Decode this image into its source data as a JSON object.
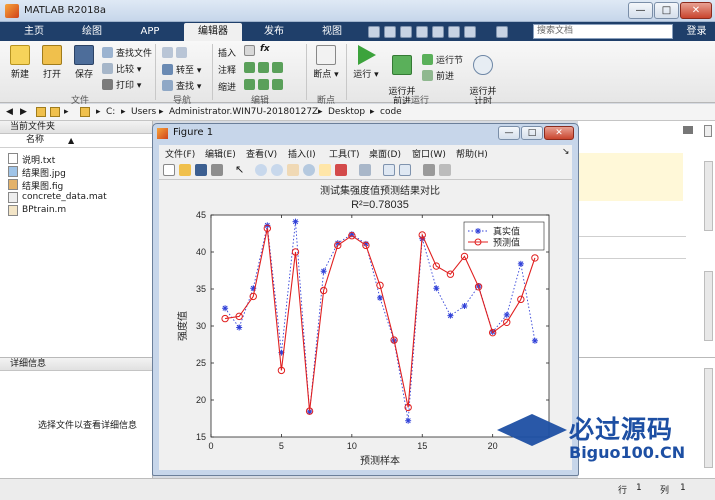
{
  "app": {
    "title": "MATLAB R2018a"
  },
  "window_controls": {
    "min": "—",
    "max": "□",
    "close": "✕"
  },
  "tabs": [
    {
      "label": "主页"
    },
    {
      "label": "绘图"
    },
    {
      "label": "APP"
    },
    {
      "label": "编辑器",
      "active": true
    },
    {
      "label": "发布"
    },
    {
      "label": "视图"
    }
  ],
  "search": {
    "placeholder": "搜索文档"
  },
  "login": "登录",
  "ribbon": {
    "file": {
      "new": "新建",
      "open": "打开",
      "save": "保存",
      "find_files": "查找文件",
      "compare": "比较",
      "print": "打印",
      "section": "文件"
    },
    "nav": {
      "goto": "转至",
      "find": "查找",
      "section": "导航"
    },
    "edit": {
      "insert": "插入",
      "comment": "注释",
      "indent": "缩进",
      "fx": "fx",
      "section": "编辑"
    },
    "breakpoints": {
      "label": "断点",
      "section": "断点"
    },
    "run": {
      "run": "运行",
      "run_advance": "运行并\n前进",
      "run_section": "运行节",
      "advance": "前进",
      "run_time": "运行并\n计时",
      "section": "运行"
    }
  },
  "address": {
    "segments": [
      "C:",
      "Users",
      "Administrator.WIN7U-20180127Z",
      "Desktop",
      "code"
    ]
  },
  "current_folder": {
    "header": "当前文件夹",
    "col_name": "名称",
    "files": [
      {
        "name": "说明.txt",
        "icon": "txt-file-icon"
      },
      {
        "name": "结果图.jpg",
        "icon": "image-file-icon"
      },
      {
        "name": "结果图.fig",
        "icon": "fig-file-icon"
      },
      {
        "name": "concrete_data.mat",
        "icon": "mat-file-icon"
      },
      {
        "name": "BPtrain.m",
        "icon": "m-file-icon"
      }
    ]
  },
  "details": {
    "header": "详细信息",
    "message": "选择文件以查看详细信息"
  },
  "status": {
    "row_label": "行",
    "row": "1",
    "col_label": "列",
    "col": "1"
  },
  "figure": {
    "title": "Figure 1",
    "menu": [
      "文件(F)",
      "编辑(E)",
      "查看(V)",
      "插入(I)",
      "工具(T)",
      "桌面(D)",
      "窗口(W)",
      "帮助(H)"
    ]
  },
  "watermark": {
    "line1": "必过源码",
    "line2": "Biguo100.CN"
  },
  "colors": {
    "series_true": "#3040d8",
    "series_pred": "#e02020",
    "tab_bar": "#1f3f6a"
  },
  "chart_data": {
    "type": "line",
    "title": "测试集强度值预测结果对比",
    "subtitle": "R²=0.78035",
    "xlabel": "预测样本",
    "ylabel": "强度值",
    "xlim": [
      0,
      24
    ],
    "ylim": [
      15,
      45
    ],
    "xticks": [
      0,
      5,
      10,
      15,
      20
    ],
    "yticks": [
      15,
      20,
      25,
      30,
      35,
      40,
      45
    ],
    "legend_position": "top-right",
    "x": [
      1,
      2,
      3,
      4,
      5,
      6,
      7,
      8,
      9,
      10,
      11,
      12,
      13,
      14,
      15,
      16,
      17,
      18,
      19,
      20,
      21,
      22,
      23
    ],
    "series": [
      {
        "name": "真实值",
        "style": "dotted",
        "marker": "star",
        "color": "#3040d8",
        "values": [
          32.4,
          29.8,
          35.1,
          43.6,
          26.4,
          44.1,
          18.4,
          37.4,
          41.2,
          42.4,
          41.1,
          33.8,
          28.0,
          17.2,
          41.8,
          35.1,
          31.4,
          32.7,
          35.4,
          29.2,
          31.5,
          38.4,
          28.0
        ]
      },
      {
        "name": "预测值",
        "style": "solid",
        "marker": "circle",
        "color": "#e02020",
        "values": [
          31.0,
          31.3,
          34.0,
          43.2,
          24.0,
          40.0,
          18.5,
          34.8,
          40.9,
          42.2,
          40.9,
          35.5,
          28.1,
          19.0,
          42.3,
          38.1,
          37.0,
          39.4,
          35.3,
          29.1,
          30.5,
          33.6,
          39.2
        ]
      }
    ]
  }
}
